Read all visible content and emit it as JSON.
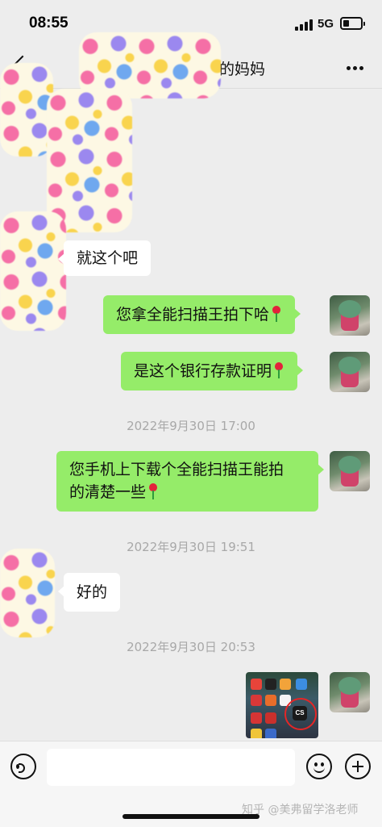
{
  "status_bar": {
    "time": "08:55",
    "network": "5G",
    "battery_level": 0.35
  },
  "header": {
    "title": "的妈妈",
    "back_icon": "chevron-left-icon",
    "more_icon": "more-horizontal-icon"
  },
  "messages": [
    {
      "direction": "in",
      "text": "就这个吧"
    },
    {
      "direction": "out",
      "text": "您拿全能扫描王拍下哈",
      "emoji": "rose-icon"
    },
    {
      "direction": "out",
      "text": "是这个银行存款证明",
      "emoji": "rose-icon"
    },
    {
      "type": "timestamp",
      "text": "2022年9月30日 17:00"
    },
    {
      "direction": "out",
      "text_line1": "您手机上下载个全能扫描王能拍",
      "text_line2": "的清楚一些",
      "emoji": "rose-icon"
    },
    {
      "type": "timestamp",
      "text": "2022年9月30日 19:51"
    },
    {
      "direction": "in",
      "text": "好的"
    },
    {
      "type": "timestamp",
      "text": "2022年9月30日 20:53"
    },
    {
      "direction": "out",
      "type": "image",
      "app_label": "CS"
    }
  ],
  "input_bar": {
    "voice_icon": "voice-icon",
    "emoji_icon": "emoji-icon",
    "add_icon": "plus-icon",
    "placeholder": ""
  },
  "watermark": "知乎 @美弗留学洛老师",
  "colors": {
    "background": "#ededed",
    "outgoing_bubble": "#95ec69",
    "incoming_bubble": "#ffffff",
    "timestamp_text": "#a8a8a8"
  }
}
